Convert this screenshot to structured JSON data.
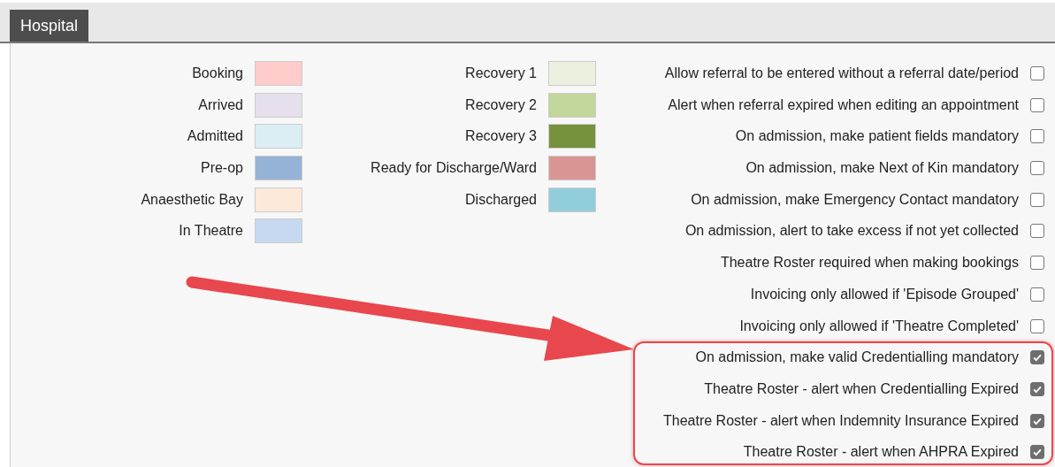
{
  "tabs": [
    {
      "label": "Hospital",
      "selected": true
    }
  ],
  "status_colors_left": [
    {
      "label": "Booking",
      "color": "#ffcccc"
    },
    {
      "label": "Arrived",
      "color": "#e6e0ec"
    },
    {
      "label": "Admitted",
      "color": "#dbeef3"
    },
    {
      "label": "Pre-op",
      "color": "#95b3d7"
    },
    {
      "label": "Anaesthetic Bay",
      "color": "#fde9d9"
    },
    {
      "label": "In Theatre",
      "color": "#c6d9f0"
    }
  ],
  "status_colors_right": [
    {
      "label": "Recovery 1",
      "color": "#ebf1de"
    },
    {
      "label": "Recovery 2",
      "color": "#c3d69b"
    },
    {
      "label": "Recovery 3",
      "color": "#76923c"
    },
    {
      "label": "Ready for Discharge/Ward",
      "color": "#d99594"
    },
    {
      "label": "Discharged",
      "color": "#92cddc"
    }
  ],
  "options": [
    {
      "label": "Allow referral to be entered without a referral date/period",
      "checked": false
    },
    {
      "label": "Alert when referral expired when editing an appointment",
      "checked": false
    },
    {
      "label": "On admission, make patient fields mandatory",
      "checked": false
    },
    {
      "label": "On admission, make Next of Kin mandatory",
      "checked": false
    },
    {
      "label": "On admission, make Emergency Contact mandatory",
      "checked": false
    },
    {
      "label": "On admission, alert to take excess if not yet collected",
      "checked": false
    },
    {
      "label": "Theatre Roster required when making bookings",
      "checked": false
    },
    {
      "label": "Invoicing only allowed if 'Episode Grouped'",
      "checked": false
    },
    {
      "label": "Invoicing only allowed if 'Theatre Completed'",
      "checked": false
    },
    {
      "label": "On admission, make valid Credentialling mandatory",
      "checked": true
    },
    {
      "label": "Theatre Roster - alert when Credentialling Expired",
      "checked": true
    },
    {
      "label": "Theatre Roster - alert when Indemnity Insurance Expired",
      "checked": true
    },
    {
      "label": "Theatre Roster - alert when AHPRA Expired",
      "checked": true
    }
  ]
}
